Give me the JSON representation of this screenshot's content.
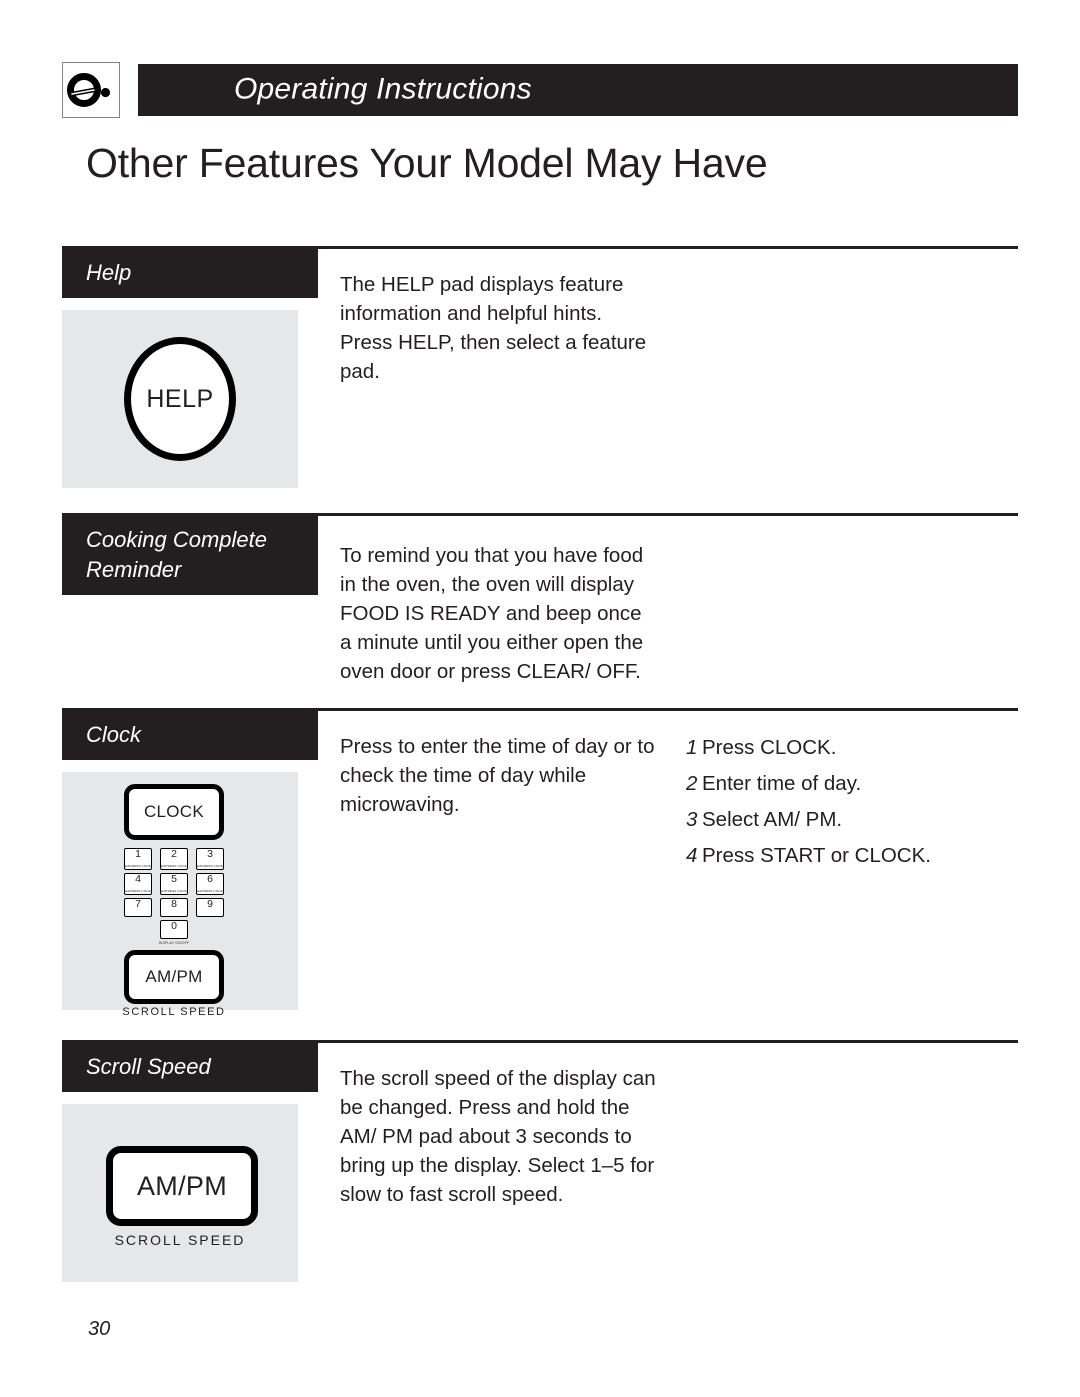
{
  "header": {
    "icon": "knob-dial-icon",
    "banner_title": "Operating Instructions",
    "page_title": "Other Features Your Model May Have"
  },
  "sections": [
    {
      "label": "Help",
      "button": {
        "text": "HELP",
        "shape": "oval"
      },
      "body": "The HELP pad displays feature information and helpful hints. Press HELP, then select a feature pad.",
      "body_lines": [
        "The HELP pad displays feature",
        "information and helpful hints.",
        "Press HELP, then select a feature",
        "pad."
      ]
    },
    {
      "label_lines": [
        "Cooking Complete",
        "Reminder"
      ],
      "label": "Cooking Complete Reminder",
      "body_lines": [
        "To remind you that you have food",
        "in the oven, the oven will display",
        " FOOD IS READY  and beep once",
        "a minute until you either open the",
        "oven door or press CLEAR/ OFF."
      ]
    },
    {
      "label": "Clock",
      "body_lines": [
        "Press to enter the time of day or to",
        "check the time of day while",
        "microwaving."
      ],
      "steps": [
        {
          "num": "1",
          "text": "Press CLOCK."
        },
        {
          "num": "2",
          "text": "Enter time of day."
        },
        {
          "num": "3",
          "text": "Select AM/ PM."
        },
        {
          "num": "4",
          "text": "Press START or CLOCK."
        }
      ],
      "control_panel": {
        "clock_button": "CLOCK",
        "ampm_button": "AM/PM",
        "ampm_caption": "SCROLL SPEED",
        "keypad": [
          {
            "digit": "1",
            "sub": "EXPRESS COOK"
          },
          {
            "digit": "2",
            "sub": "EXPRESS COOK"
          },
          {
            "digit": "3",
            "sub": "EXPRESS COOK"
          },
          {
            "digit": "4",
            "sub": "EXPRESS COOK"
          },
          {
            "digit": "5",
            "sub": "EXPRESS COOK"
          },
          {
            "digit": "6",
            "sub": "EXPRESS COOK"
          },
          {
            "digit": "7",
            "sub": ""
          },
          {
            "digit": "8",
            "sub": ""
          },
          {
            "digit": "9",
            "sub": ""
          },
          {
            "digit": "0",
            "sub": ""
          }
        ],
        "zero_caption": "DISPLAY ON/OFF"
      }
    },
    {
      "label": "Scroll Speed",
      "button": {
        "text": "AM/PM",
        "caption": "SCROLL SPEED"
      },
      "body_lines": [
        "The scroll speed of the display can",
        "be changed. Press and hold the",
        "AM/ PM pad about 3 seconds to",
        "bring up the display. Select 1–5 for",
        "slow to fast scroll speed."
      ]
    }
  ],
  "footer": {
    "page_number": "30"
  },
  "colors": {
    "ink": "#231f20",
    "panel": "#e6e7e8",
    "paper": "#ffffff"
  }
}
